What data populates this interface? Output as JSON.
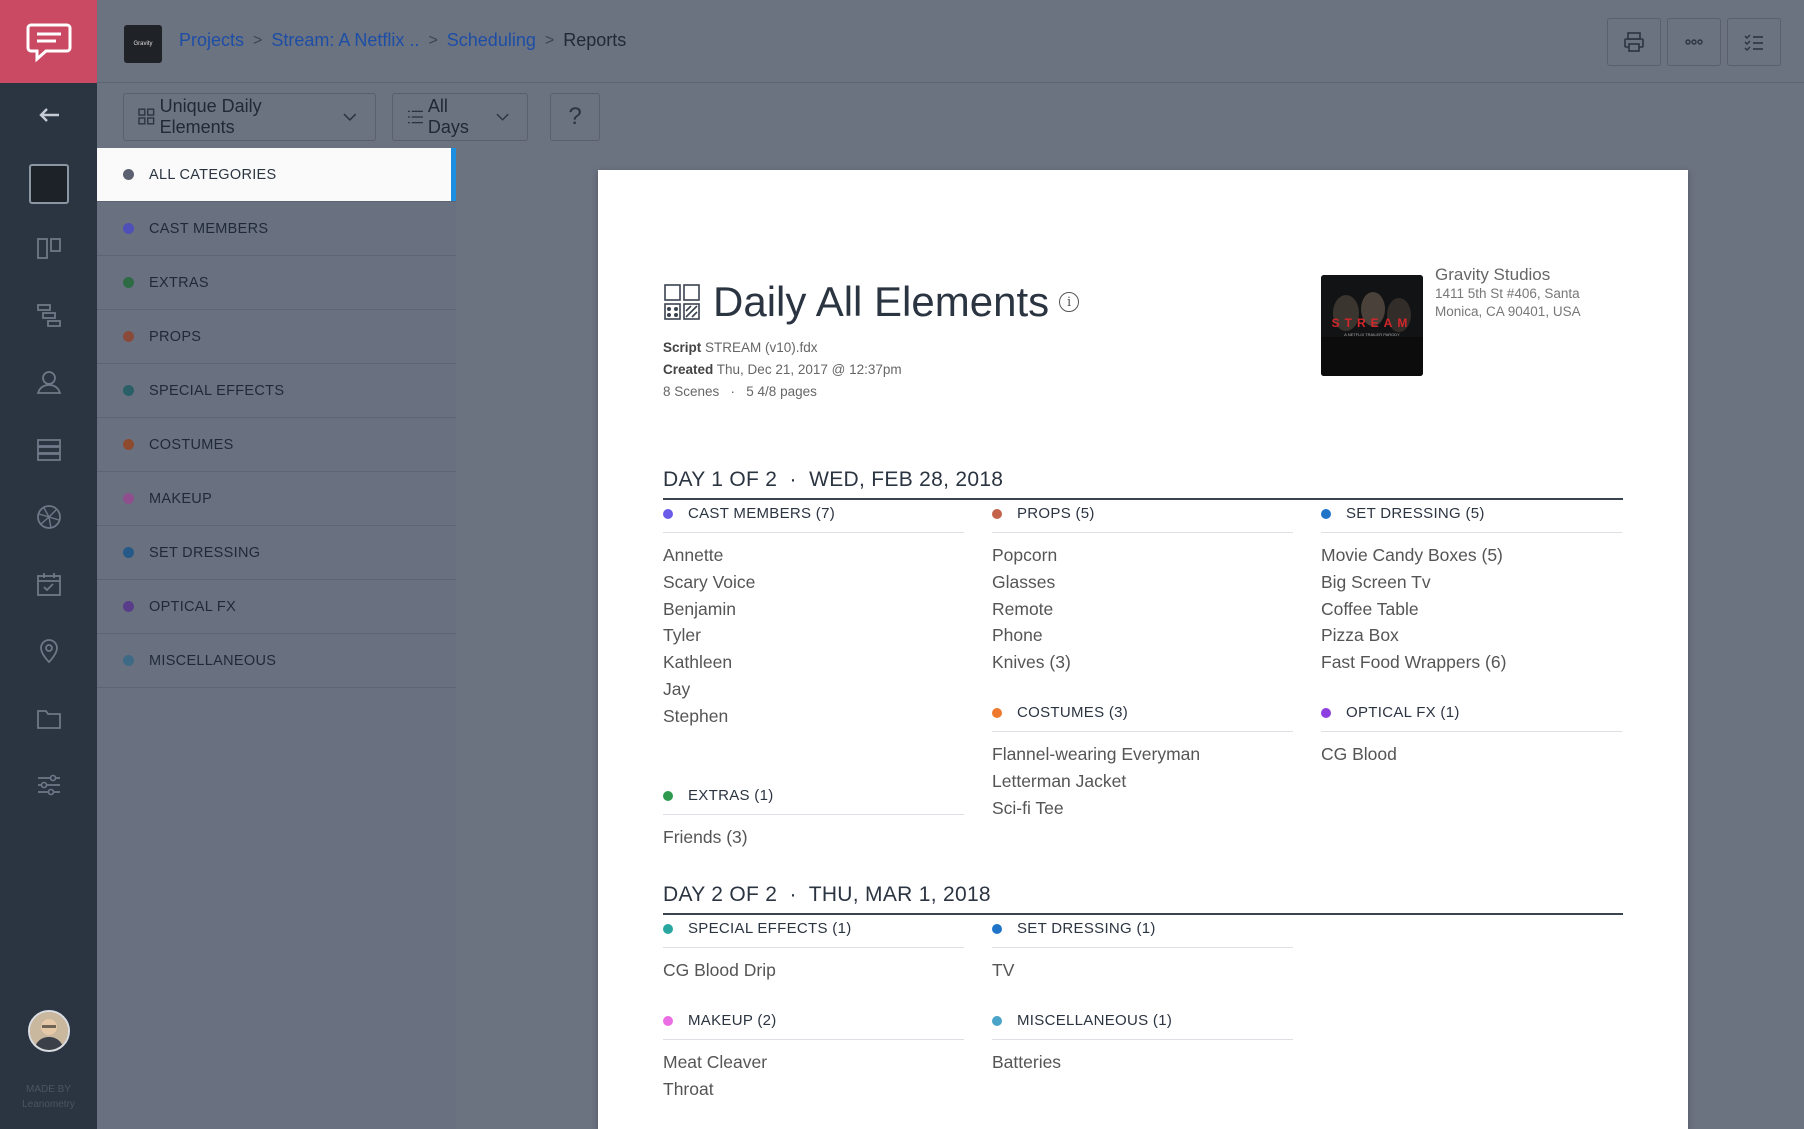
{
  "rail": {
    "made_by_line1": "MADE BY",
    "made_by_line2": "Leanometry",
    "icons": [
      "chat-logo-icon",
      "back-arrow-icon",
      "project-thumbnail",
      "board-icon",
      "stripboard-icon",
      "cast-icon",
      "list-icon",
      "aperture-icon",
      "calendar-icon",
      "location-pin-icon",
      "folder-icon",
      "sliders-icon",
      "user-avatar"
    ]
  },
  "topbar": {
    "project_thumb_text": "Gravity",
    "breadcrumb": [
      {
        "label": "Projects"
      },
      {
        "label": "Stream: A Netflix .."
      },
      {
        "label": "Scheduling"
      }
    ],
    "current": "Reports",
    "buttons": [
      "print-icon",
      "more-icon",
      "checklist-icon"
    ]
  },
  "toolbar": {
    "report_select": "Unique Daily Elements",
    "days_select": "All Days",
    "help_label": "?"
  },
  "categories": [
    {
      "label": "ALL CATEGORIES",
      "color": "#5b6170",
      "active": true
    },
    {
      "label": "CAST MEMBERS",
      "color": "#4f4fb8"
    },
    {
      "label": "EXTRAS",
      "color": "#2d6b45"
    },
    {
      "label": "PROPS",
      "color": "#8a4a3a"
    },
    {
      "label": "SPECIAL EFFECTS",
      "color": "#2a5f68"
    },
    {
      "label": "COSTUMES",
      "color": "#8e4a2f"
    },
    {
      "label": "MAKEUP",
      "color": "#8f4f8e"
    },
    {
      "label": "SET DRESSING",
      "color": "#255a88"
    },
    {
      "label": "OPTICAL FX",
      "color": "#5a3d8a"
    },
    {
      "label": "MISCELLANEOUS",
      "color": "#3e6a86"
    }
  ],
  "report": {
    "title": "Daily All Elements",
    "script_label": "Script",
    "script_value": "STREAM (v10).fdx",
    "created_label": "Created",
    "created_value": "Thu, Dec 21, 2017 @ 12:37pm",
    "stats": "8 Scenes   ·   5 4/8 pages",
    "studio_name": "Gravity Studios",
    "studio_addr1": "1411 5th St #406, Santa",
    "studio_addr2": "Monica, CA 90401, USA",
    "poster_text": "STREAM",
    "poster_sub": "A NETFLIX TRAILER PARODY",
    "days": [
      {
        "header": "DAY 1 OF 2  ·  WED, FEB 28, 2018",
        "groups": [
          {
            "title": "CAST MEMBERS (7)",
            "color": "#6a5ce8",
            "items": [
              "Annette",
              "Scary Voice",
              "Benjamin",
              "Tyler",
              "Kathleen",
              "Jay",
              "Stephen"
            ]
          },
          {
            "title": "EXTRAS (1)",
            "color": "#2f9a4f",
            "items": [
              "Friends (3)"
            ]
          },
          {
            "title": "PROPS (5)",
            "color": "#c4634a",
            "items": [
              "Popcorn",
              "Glasses",
              "Remote",
              "Phone",
              "Knives (3)"
            ]
          },
          {
            "title": "COSTUMES (3)",
            "color": "#ef7a2e",
            "items": [
              "Flannel-wearing Everyman",
              "Letterman Jacket",
              "Sci-fi Tee"
            ]
          },
          {
            "title": "SET DRESSING (5)",
            "color": "#1f74c8",
            "items": [
              "Movie Candy Boxes (5)",
              "Big Screen Tv",
              "Coffee Table",
              "Pizza Box",
              "Fast Food Wrappers (6)"
            ]
          },
          {
            "title": "OPTICAL FX (1)",
            "color": "#8e3fe0",
            "items": [
              "CG Blood"
            ]
          }
        ]
      },
      {
        "header": "DAY 2 OF 2  ·  THU, MAR 1, 2018",
        "groups": [
          {
            "title": "SPECIAL EFFECTS (1)",
            "color": "#2aa6a0",
            "items": [
              "CG Blood Drip"
            ]
          },
          {
            "title": "MAKEUP (2)",
            "color": "#ea6fe4",
            "items": [
              "Meat Cleaver",
              "Throat"
            ]
          },
          {
            "title": "SET DRESSING (1)",
            "color": "#1f74c8",
            "items": [
              "TV"
            ]
          },
          {
            "title": "MISCELLANEOUS (1)",
            "color": "#4aa3c8",
            "items": [
              "Batteries"
            ]
          }
        ]
      }
    ]
  }
}
